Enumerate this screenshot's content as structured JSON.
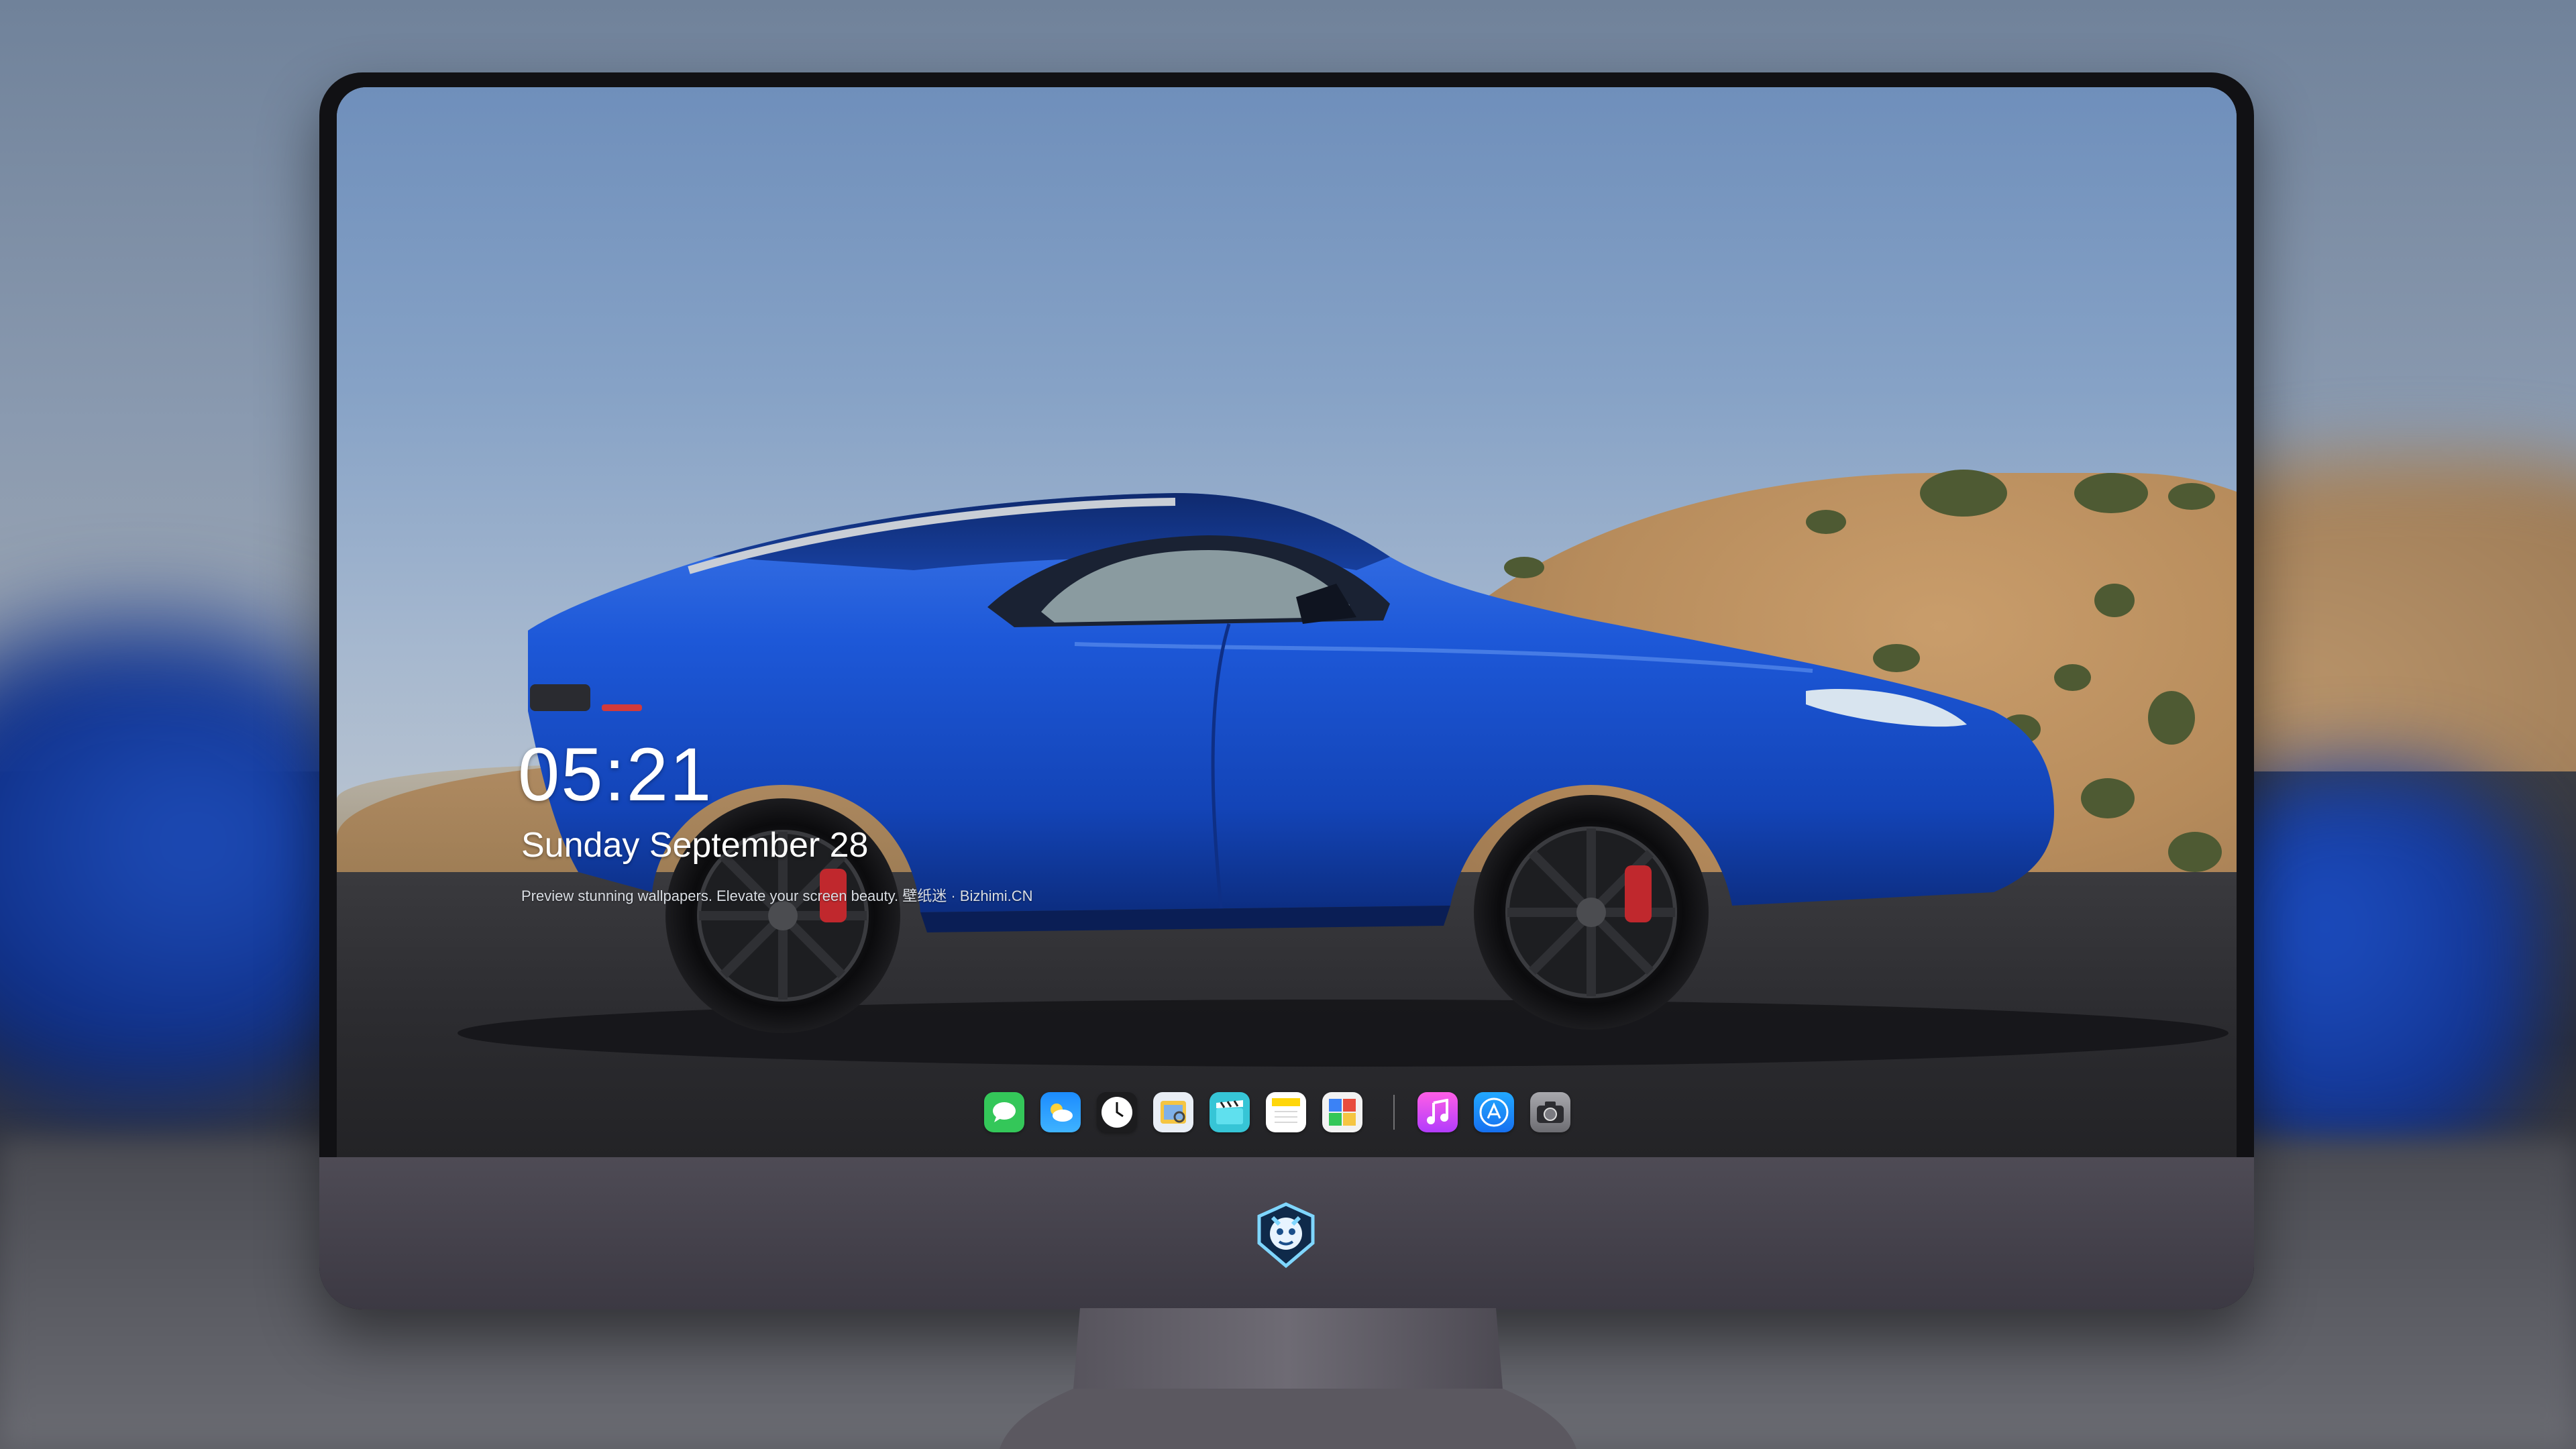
{
  "lockscreen": {
    "time": "05:21",
    "date": "Sunday September  28",
    "tagline": "Preview stunning wallpapers. Elevate your screen beauty. 壁纸迷 · Bizhimi.CN"
  },
  "dock": {
    "apps": [
      {
        "name": "messages-icon",
        "color": "#34c759"
      },
      {
        "name": "weather-icon",
        "color": "#1e90ff"
      },
      {
        "name": "clock-icon",
        "color": "#1c1c1e"
      },
      {
        "name": "preview-icon",
        "color": "#f5c542"
      },
      {
        "name": "clips-icon",
        "color": "#36c5d6"
      },
      {
        "name": "notes-icon",
        "color": "#ffd60a"
      },
      {
        "name": "photo-booth-icon",
        "color": "#e84c3d"
      },
      {
        "name": "music-icon",
        "color": "#c644fc"
      },
      {
        "name": "app-store-icon",
        "color": "#1a8cff"
      },
      {
        "name": "camera-icon",
        "color": "#8e8e93"
      }
    ]
  },
  "monitor": {
    "bezel_color": "#111114",
    "chin_color": "#47444e",
    "logo": "dragon-mascot-icon"
  }
}
